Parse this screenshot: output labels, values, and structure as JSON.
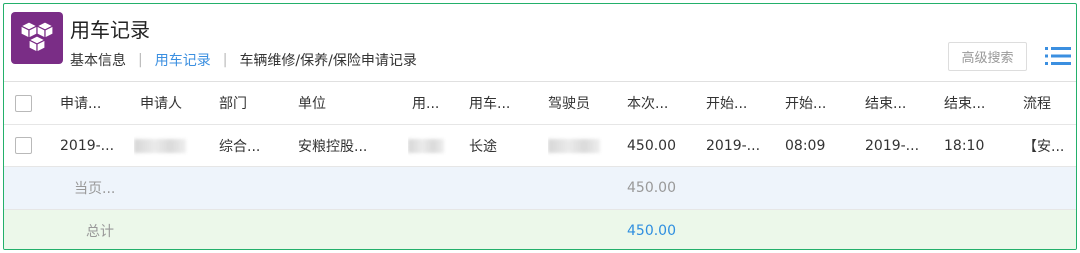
{
  "header": {
    "title": "用车记录",
    "tabs": [
      {
        "label": "基本信息",
        "active": false
      },
      {
        "label": "用车记录",
        "active": true
      },
      {
        "label": "车辆维修/保养/保险申请记录",
        "active": false
      }
    ],
    "advanced_search_label": "高级搜索"
  },
  "table": {
    "columns": [
      "申请...",
      "申请人",
      "部门",
      "单位",
      "用...",
      "用车...",
      "驾驶员",
      "本次...",
      "开始...",
      "开始...",
      "结束...",
      "结束...",
      "流程"
    ],
    "rows": [
      {
        "apply_date": "2019-...",
        "applicant": "",
        "department": "综合...",
        "unit": "安粮控股...",
        "use_col": "",
        "use_type": "长途",
        "driver": "",
        "amount": "450.00",
        "start_date": "2019-...",
        "start_time": "08:09",
        "end_date": "2019-...",
        "end_time": "18:10",
        "process": "【安..."
      }
    ],
    "page_summary_label": "当页...",
    "page_summary_value": "450.00",
    "total_label": "总计",
    "total_value": "450.00"
  },
  "colors": {
    "accent": "#3b8fe0",
    "icon_bg": "#7a2d86",
    "page_row_bg": "#eef4fb",
    "total_row_bg": "#ecf8ea"
  }
}
